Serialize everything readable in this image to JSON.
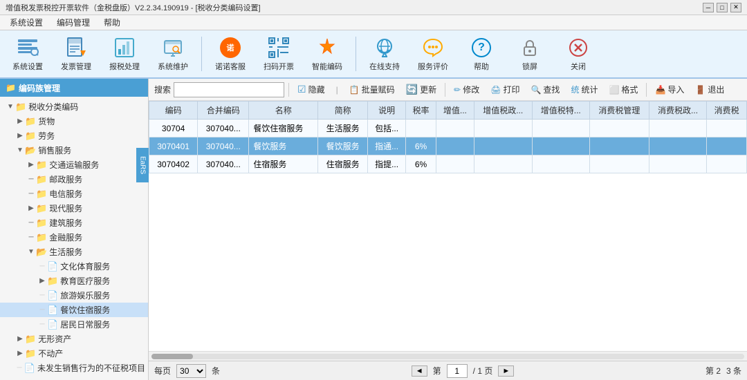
{
  "titleBar": {
    "text": "增值税发票税控开票软件（金税盘版）V2.2.34.190919 - [税收分类编码设置]",
    "controls": [
      "minimize",
      "maximize",
      "close"
    ]
  },
  "menuBar": {
    "items": [
      "系统设置",
      "编码管理",
      "帮助"
    ]
  },
  "toolbar": {
    "buttons": [
      {
        "id": "sys-settings",
        "label": "系统设置",
        "icon": "⚙"
      },
      {
        "id": "invoice-mgr",
        "label": "发票管理",
        "icon": "📄"
      },
      {
        "id": "tax-process",
        "label": "报税处理",
        "icon": "📊"
      },
      {
        "id": "sys-maintain",
        "label": "系统维护",
        "icon": "🔧"
      },
      {
        "id": "nuonuo",
        "label": "诺诺客服",
        "icon": "诺"
      },
      {
        "id": "scan-invoice",
        "label": "扫码开票",
        "icon": "⬛"
      },
      {
        "id": "smart-code",
        "label": "智能编码",
        "icon": "⭐"
      },
      {
        "id": "online-support",
        "label": "在线支持",
        "icon": "💬"
      },
      {
        "id": "evaluate",
        "label": "服务评价",
        "icon": "⭐"
      },
      {
        "id": "help",
        "label": "帮助",
        "icon": "?"
      },
      {
        "id": "lock",
        "label": "锁屏",
        "icon": "🔒"
      },
      {
        "id": "close-app",
        "label": "关闭",
        "icon": "✕"
      }
    ]
  },
  "leftPanel": {
    "title": "编码族管理",
    "treeItems": [
      {
        "id": "root",
        "label": "税收分类编码",
        "level": 0,
        "expanded": true,
        "type": "root"
      },
      {
        "id": "goods",
        "label": "货物",
        "level": 1,
        "expanded": false,
        "type": "folder"
      },
      {
        "id": "labor",
        "label": "劳务",
        "level": 1,
        "expanded": false,
        "type": "folder"
      },
      {
        "id": "sales-service",
        "label": "销售服务",
        "level": 1,
        "expanded": true,
        "type": "folder"
      },
      {
        "id": "transport",
        "label": "交通运输服务",
        "level": 2,
        "expanded": false,
        "type": "folder"
      },
      {
        "id": "postal",
        "label": "邮政服务",
        "level": 2,
        "expanded": false,
        "type": "folder"
      },
      {
        "id": "telecom",
        "label": "电信服务",
        "level": 2,
        "expanded": false,
        "type": "folder"
      },
      {
        "id": "modern",
        "label": "现代服务",
        "level": 2,
        "expanded": false,
        "type": "folder"
      },
      {
        "id": "construction",
        "label": "建筑服务",
        "level": 2,
        "expanded": false,
        "type": "folder"
      },
      {
        "id": "finance",
        "label": "金融服务",
        "level": 2,
        "expanded": false,
        "type": "folder"
      },
      {
        "id": "life",
        "label": "生活服务",
        "level": 2,
        "expanded": true,
        "type": "folder"
      },
      {
        "id": "culture",
        "label": "文化体育服务",
        "level": 3,
        "expanded": false,
        "type": "file"
      },
      {
        "id": "education",
        "label": "教育医疗服务",
        "level": 3,
        "expanded": false,
        "type": "folder"
      },
      {
        "id": "tourism",
        "label": "旅游娱乐服务",
        "level": 3,
        "expanded": false,
        "type": "file"
      },
      {
        "id": "catering",
        "label": "餐饮住宿服务",
        "level": 3,
        "expanded": false,
        "type": "file",
        "selected": true
      },
      {
        "id": "residents",
        "label": "居民日常服务",
        "level": 3,
        "expanded": false,
        "type": "file"
      },
      {
        "id": "intangible",
        "label": "无形资产",
        "level": 1,
        "expanded": false,
        "type": "folder"
      },
      {
        "id": "real-estate",
        "label": "不动产",
        "level": 1,
        "expanded": false,
        "type": "folder"
      },
      {
        "id": "non-tax",
        "label": "未发生销售行为的不征税项目",
        "level": 1,
        "expanded": false,
        "type": "file"
      }
    ]
  },
  "rightToolbar": {
    "searchLabel": "搜索",
    "searchPlaceholder": "",
    "buttons": [
      {
        "id": "hide",
        "label": "隐藏",
        "icon": "☑"
      },
      {
        "id": "batch-code",
        "label": "批量赋码",
        "icon": "📋"
      },
      {
        "id": "update",
        "label": "更新",
        "icon": "🔄"
      },
      {
        "id": "modify",
        "label": "修改",
        "icon": "✏"
      },
      {
        "id": "print",
        "label": "打印",
        "icon": "🖨"
      },
      {
        "id": "query",
        "label": "查找",
        "icon": "🔍"
      },
      {
        "id": "stat",
        "label": "统计",
        "icon": "📊"
      },
      {
        "id": "format",
        "label": "格式",
        "icon": "⬜"
      },
      {
        "id": "import",
        "label": "导入",
        "icon": "📥"
      },
      {
        "id": "exit",
        "label": "退出",
        "icon": "🚪"
      }
    ]
  },
  "table": {
    "columns": [
      "编码",
      "合并编码",
      "名称",
      "简称",
      "说明",
      "税率",
      "增值...",
      "增值税政...",
      "增值税特...",
      "消费税管理",
      "消费税政...",
      "消费税"
    ],
    "rows": [
      {
        "id": "30704",
        "code": "30704",
        "mergeCode": "307040...",
        "name": "餐饮住宿服务",
        "shortName": "生活服务",
        "desc": "包括...",
        "taxRate": "",
        "v1": "",
        "v2": "",
        "v3": "",
        "c1": "",
        "c2": "",
        "c3": "",
        "selected": false
      },
      {
        "id": "3070401",
        "code": "3070401",
        "mergeCode": "307040...",
        "name": "餐饮服务",
        "shortName": "餐饮服务",
        "desc": "指通...",
        "taxRate": "6%",
        "v1": "",
        "v2": "",
        "v3": "",
        "c1": "",
        "c2": "",
        "c3": "",
        "selected": true
      },
      {
        "id": "3070402",
        "code": "3070402",
        "mergeCode": "307040...",
        "name": "住宿服务",
        "shortName": "住宿服务",
        "desc": "指提...",
        "taxRate": "6%",
        "v1": "",
        "v2": "",
        "v3": "",
        "c1": "",
        "c2": "",
        "c3": "",
        "selected": false
      }
    ]
  },
  "pagination": {
    "perPageLabel": "每页",
    "perPageValue": "30",
    "perPageSuffix": "条",
    "prevLabel": "◄",
    "pageLabel": "第",
    "currentPage": "1",
    "totalPageLabel": "/ 1 页",
    "nextLabel": "►",
    "page2": "第 2",
    "page3": "3 条"
  },
  "blueTab": {
    "text": "EaRS"
  }
}
